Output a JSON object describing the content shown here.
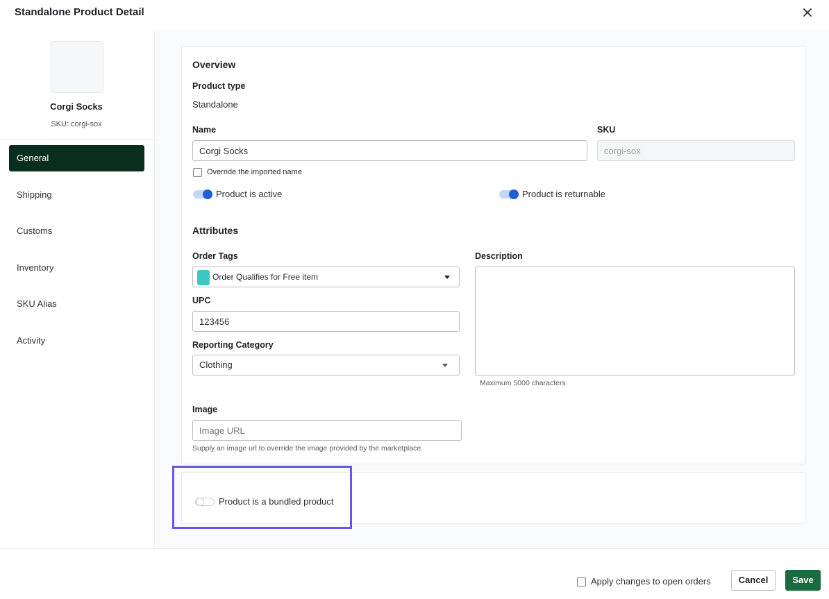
{
  "header": {
    "title": "Standalone Product Detail",
    "close_icon": "close-icon"
  },
  "sidebar": {
    "product_name": "Corgi Socks",
    "product_sku": "SKU: corgi-sox",
    "items": [
      {
        "label": "General",
        "active": true
      },
      {
        "label": "Shipping",
        "active": false
      },
      {
        "label": "Customs",
        "active": false
      },
      {
        "label": "Inventory",
        "active": false
      },
      {
        "label": "SKU Alias",
        "active": false
      },
      {
        "label": "Activity",
        "active": false
      }
    ]
  },
  "overview": {
    "title": "Overview",
    "product_type_label": "Product type",
    "product_type_value": "Standalone",
    "name_label": "Name",
    "name_value": "Corgi Socks",
    "sku_label": "SKU",
    "sku_value": "corgi-sox",
    "override_label": "Override the imported name",
    "override_checked": false,
    "active_label": "Product is active",
    "active_on": true,
    "returnable_label": "Product is returnable",
    "returnable_on": true
  },
  "attributes": {
    "title": "Attributes",
    "order_tags_label": "Order Tags",
    "order_tag_value": "Order Qualifies for Free item",
    "order_tag_color": "#3cc9c3",
    "upc_label": "UPC",
    "upc_value": "123456",
    "reporting_label": "Reporting Category",
    "reporting_value": "Clothing",
    "description_label": "Description",
    "description_value": "",
    "description_hint": "Maximum 5000 characters",
    "image_label": "Image",
    "image_placeholder": "Image URL",
    "image_hint": "Supply an image url to override the image provided by the marketplace."
  },
  "bundle": {
    "label": "Product is a bundled product",
    "on": false
  },
  "footer": {
    "apply_label": "Apply changes to open orders",
    "apply_checked": false,
    "cancel_label": "Cancel",
    "save_label": "Save"
  },
  "colors": {
    "active_nav": "#0a2e1e",
    "save_button": "#1a6b3f",
    "toggle_on": "#1e5ed6",
    "highlight": "#6757e6"
  }
}
